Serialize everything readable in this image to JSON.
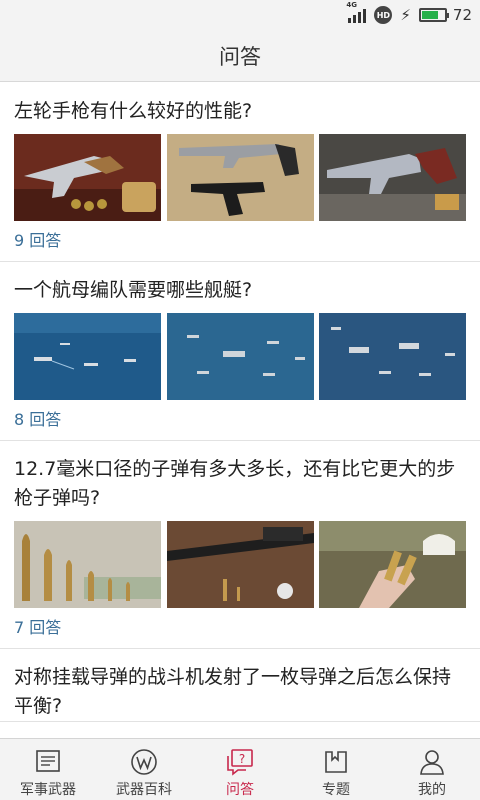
{
  "status_bar": {
    "network": "4G",
    "hd": "HD",
    "battery_level": 0.72,
    "battery_text": "72"
  },
  "header": {
    "title": "问答"
  },
  "questions": [
    {
      "title": "左轮手枪有什么较好的性能?",
      "answers": "9 回答",
      "images": [
        "revolver-ammo-photo",
        "pistols-on-wood-photo",
        "revolver-ammo-photo"
      ]
    },
    {
      "title": "一个航母编队需要哪些舰艇?",
      "answers": "8 回答",
      "images": [
        "fleet-formation-photo",
        "fleet-formation-photo",
        "fleet-formation-photo"
      ]
    },
    {
      "title": "12.7毫米口径的子弹有多大多长，还有比它更大的步枪子弹吗?",
      "answers": "7 回答",
      "images": [
        "bullets-row-photo",
        "sniper-rifle-ammo-photo",
        "hand-holding-cartridges-photo"
      ]
    },
    {
      "title": "对称挂载导弹的战斗机发射了一枚导弹之后怎么保持平衡?"
    }
  ],
  "bottom_nav": [
    {
      "label": "军事武器",
      "icon": "news-icon",
      "active": false
    },
    {
      "label": "武器百科",
      "icon": "wiki-icon",
      "active": false
    },
    {
      "label": "问答",
      "icon": "qa-icon",
      "active": true
    },
    {
      "label": "专题",
      "icon": "topic-icon",
      "active": false
    },
    {
      "label": "我的",
      "icon": "profile-icon",
      "active": false
    }
  ],
  "colors": {
    "accent": "#c8284c",
    "answer_count": "#3b6f98",
    "battery": "#27b04a"
  }
}
